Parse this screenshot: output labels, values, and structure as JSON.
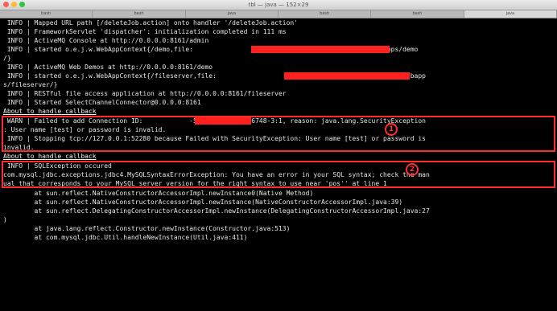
{
  "window": {
    "title": "tbl — java — 152×29",
    "tabs": [
      "bash",
      "bash",
      "java",
      "bash",
      "bash",
      "java"
    ]
  },
  "lines": [
    " INFO | Mapped URL path [/deleteJob.action] onto handler '/deleteJob.action'",
    " INFO | FrameworkServlet 'dispatcher': initialization completed in 111 ms",
    " INFO | ActiveMQ Console at http://0.0.0.0:8161/admin",
    " INFO | started o.e.j.w.WebAppContext{/demo,file:                        apache-activemq-5.6.0/webapps/demo",
    "/}",
    " INFO | ActiveMQ Web Demos at http://0.0.0.0:8161/demo",
    " INFO | started o.e.j.w.WebAppContext{/fileserver,file:                          apache-activemq-5.6.0/webapp",
    "s/fileserver/}",
    " INFO | RESTful file access application at http://0.0.0.0:8161/fileserver",
    " INFO | Started SelectChannelConnector@0.0.0.0:8161",
    "About to handle callback",
    " WARN | Failed to add Connection ID:            -52279-1365303226748-3:1, reason: java.lang.SecurityException",
    ": User name [test] or password is invalid.",
    " INFO | Stopping tcp://127.0.0.1:52280 because Failed with SecurityException: User name [test] or password is",
    "invalid.",
    "About to handle callback",
    " INFO | SQLException occured",
    "com.mysql.jdbc.exceptions.jdbc4.MySQLSyntaxErrorException: You have an error in your SQL syntax; check the man",
    "ual that corresponds to your MySQL server version for the right syntax to use near 'pos'' at line 1",
    "        at sun.reflect.NativeConstructorAccessorImpl.newInstance0(Native Method)",
    "        at sun.reflect.NativeConstructorAccessorImpl.newInstance(NativeConstructorAccessorImpl.java:39)",
    "        at sun.reflect.DelegatingConstructorAccessorImpl.newInstance(DelegatingConstructorAccessorImpl.java:27",
    ")",
    "        at java.lang.reflect.Constructor.newInstance(Constructor.java:513)",
    "        at com.mysql.jdbc.Util.handleNewInstance(Util.java:411)"
  ],
  "annotations": {
    "marker1": "1",
    "marker2": "2"
  },
  "colors": {
    "background": "#000000",
    "text": "#e6e6e6",
    "highlight": "#ff2a2a"
  }
}
